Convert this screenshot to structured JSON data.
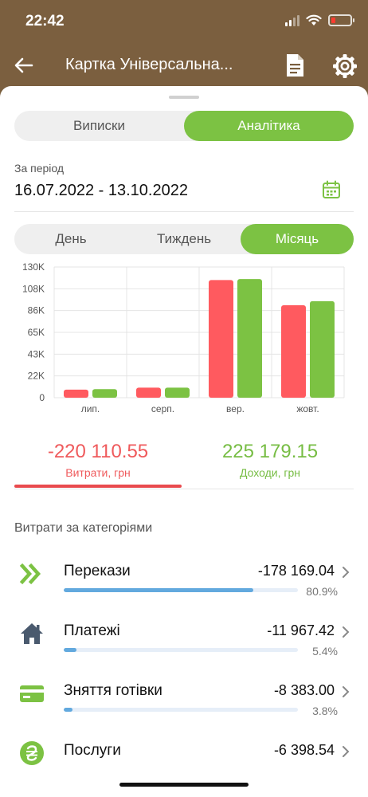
{
  "status_bar": {
    "time": "22:42"
  },
  "nav": {
    "title": "Картка Універсальна..."
  },
  "view_tabs": [
    {
      "label": "Виписки",
      "active": false
    },
    {
      "label": "Аналітика",
      "active": true
    }
  ],
  "period": {
    "label": "За період",
    "value": "16.07.2022 - 13.10.2022"
  },
  "granularity_tabs": [
    {
      "label": "День",
      "active": false
    },
    {
      "label": "Тиждень",
      "active": false
    },
    {
      "label": "Місяць",
      "active": true
    }
  ],
  "colors": {
    "brand": "#7b5f3f",
    "accent": "#7cc243",
    "expense": "#ef5a5c",
    "income": "#77bd44",
    "progress": "#62a9de"
  },
  "chart_data": {
    "type": "bar",
    "categories": [
      "лип.",
      "серп.",
      "вер.",
      "жовт."
    ],
    "series": [
      {
        "color": "#ff5a5f",
        "values": [
          8000,
          10000,
          117000,
          92000
        ]
      },
      {
        "color": "#7cc243",
        "values": [
          8500,
          10000,
          118000,
          96000
        ]
      }
    ],
    "yticks": [
      "0",
      "22K",
      "43K",
      "65K",
      "86K",
      "108K",
      "130K"
    ],
    "ylim": [
      0,
      130000
    ],
    "grid": true
  },
  "totals": {
    "expense_amount": "-220 110.55",
    "expense_label": "Витрати, грн",
    "income_amount": "225 179.15",
    "income_label": "Доходи, грн"
  },
  "categories_title": "Витрати за категоріями",
  "categories": [
    {
      "name": "Перекази",
      "amount": "-178 169.04",
      "percent": "80.9%",
      "fraction": 0.809,
      "icon": "double-chevron-right-icon",
      "icon_color": "#7cc243"
    },
    {
      "name": "Платежі",
      "amount": "-11 967.42",
      "percent": "5.4%",
      "fraction": 0.054,
      "icon": "house-icon",
      "icon_color": "#4a5a6e"
    },
    {
      "name": "Зняття готівки",
      "amount": "-8 383.00",
      "percent": "3.8%",
      "fraction": 0.038,
      "icon": "card-icon",
      "icon_color": "#7cc243"
    },
    {
      "name": "Послуги",
      "amount": "-6 398.54",
      "percent": "",
      "fraction": 0.029,
      "icon": "hryvnia-coin-icon",
      "icon_color": "#7cc243"
    }
  ]
}
